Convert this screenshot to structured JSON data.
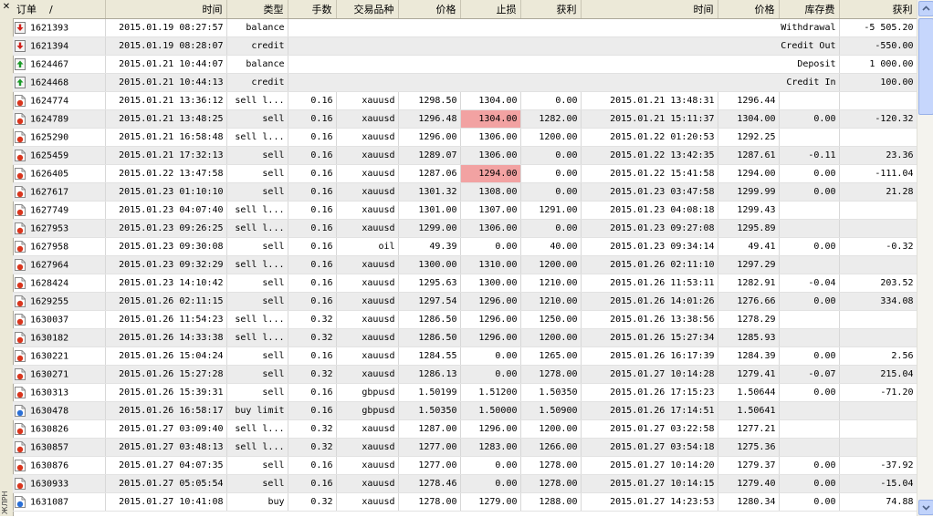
{
  "header": {
    "order": "订单",
    "sort_mark": "/",
    "open_time": "时间",
    "type": "类型",
    "lots": "手数",
    "symbol": "交易品种",
    "open_price": "价格",
    "stop_loss": "止损",
    "take_profit": "获利",
    "close_time": "时间",
    "close_price": "价格",
    "swap": "库存费",
    "profit": "获利"
  },
  "side_label": "ЖЛРН",
  "balance_rows": [
    {
      "icon": "withdraw-icon",
      "order": "1621393",
      "time": "2015.01.19 08:27:57",
      "type": "balance",
      "comment": "Withdrawal",
      "amount": "-5 505.20"
    },
    {
      "icon": "withdraw-icon",
      "order": "1621394",
      "time": "2015.01.19 08:28:07",
      "type": "credit",
      "comment": "Credit Out",
      "amount": "-550.00"
    },
    {
      "icon": "deposit-icon",
      "order": "1624467",
      "time": "2015.01.21 10:44:07",
      "type": "balance",
      "comment": "Deposit",
      "amount": "1 000.00"
    },
    {
      "icon": "deposit-icon",
      "order": "1624468",
      "time": "2015.01.21 10:44:13",
      "type": "credit",
      "comment": "Credit In",
      "amount": "100.00"
    }
  ],
  "trade_rows": [
    {
      "icon": "sell-order-icon",
      "order": "1624774",
      "open_time": "2015.01.21 13:36:12",
      "type": "sell l...",
      "lots": "0.16",
      "symbol": "xauusd",
      "open_price": "1298.50",
      "sl": "1304.00",
      "tp": "0.00",
      "close_time": "2015.01.21 13:48:31",
      "close_price": "1296.44",
      "swap": "",
      "profit": ""
    },
    {
      "icon": "sell-order-icon",
      "order": "1624789",
      "open_time": "2015.01.21 13:48:25",
      "type": "sell",
      "lots": "0.16",
      "symbol": "xauusd",
      "open_price": "1296.48",
      "sl": "1304.00",
      "tp": "1282.00",
      "close_time": "2015.01.21 15:11:37",
      "close_price": "1304.00",
      "swap": "0.00",
      "profit": "-120.32",
      "sl_hit": true
    },
    {
      "icon": "sell-order-icon",
      "order": "1625290",
      "open_time": "2015.01.21 16:58:48",
      "type": "sell l...",
      "lots": "0.16",
      "symbol": "xauusd",
      "open_price": "1296.00",
      "sl": "1306.00",
      "tp": "1200.00",
      "close_time": "2015.01.22 01:20:53",
      "close_price": "1292.25",
      "swap": "",
      "profit": ""
    },
    {
      "icon": "sell-order-icon",
      "order": "1625459",
      "open_time": "2015.01.21 17:32:13",
      "type": "sell",
      "lots": "0.16",
      "symbol": "xauusd",
      "open_price": "1289.07",
      "sl": "1306.00",
      "tp": "0.00",
      "close_time": "2015.01.22 13:42:35",
      "close_price": "1287.61",
      "swap": "-0.11",
      "profit": "23.36"
    },
    {
      "icon": "sell-order-icon",
      "order": "1626405",
      "open_time": "2015.01.22 13:47:58",
      "type": "sell",
      "lots": "0.16",
      "symbol": "xauusd",
      "open_price": "1287.06",
      "sl": "1294.00",
      "tp": "0.00",
      "close_time": "2015.01.22 15:41:58",
      "close_price": "1294.00",
      "swap": "0.00",
      "profit": "-111.04",
      "sl_hit": true
    },
    {
      "icon": "sell-order-icon",
      "order": "1627617",
      "open_time": "2015.01.23 01:10:10",
      "type": "sell",
      "lots": "0.16",
      "symbol": "xauusd",
      "open_price": "1301.32",
      "sl": "1308.00",
      "tp": "0.00",
      "close_time": "2015.01.23 03:47:58",
      "close_price": "1299.99",
      "swap": "0.00",
      "profit": "21.28"
    },
    {
      "icon": "sell-order-icon",
      "order": "1627749",
      "open_time": "2015.01.23 04:07:40",
      "type": "sell l...",
      "lots": "0.16",
      "symbol": "xauusd",
      "open_price": "1301.00",
      "sl": "1307.00",
      "tp": "1291.00",
      "close_time": "2015.01.23 04:08:18",
      "close_price": "1299.43",
      "swap": "",
      "profit": ""
    },
    {
      "icon": "sell-order-icon",
      "order": "1627953",
      "open_time": "2015.01.23 09:26:25",
      "type": "sell l...",
      "lots": "0.16",
      "symbol": "xauusd",
      "open_price": "1299.00",
      "sl": "1306.00",
      "tp": "0.00",
      "close_time": "2015.01.23 09:27:08",
      "close_price": "1295.89",
      "swap": "",
      "profit": ""
    },
    {
      "icon": "sell-order-icon",
      "order": "1627958",
      "open_time": "2015.01.23 09:30:08",
      "type": "sell",
      "lots": "0.16",
      "symbol": "oil",
      "open_price": "49.39",
      "sl": "0.00",
      "tp": "40.00",
      "close_time": "2015.01.23 09:34:14",
      "close_price": "49.41",
      "swap": "0.00",
      "profit": "-0.32"
    },
    {
      "icon": "sell-order-icon",
      "order": "1627964",
      "open_time": "2015.01.23 09:32:29",
      "type": "sell l...",
      "lots": "0.16",
      "symbol": "xauusd",
      "open_price": "1300.00",
      "sl": "1310.00",
      "tp": "1200.00",
      "close_time": "2015.01.26 02:11:10",
      "close_price": "1297.29",
      "swap": "",
      "profit": ""
    },
    {
      "icon": "sell-order-icon",
      "order": "1628424",
      "open_time": "2015.01.23 14:10:42",
      "type": "sell",
      "lots": "0.16",
      "symbol": "xauusd",
      "open_price": "1295.63",
      "sl": "1300.00",
      "tp": "1210.00",
      "close_time": "2015.01.26 11:53:11",
      "close_price": "1282.91",
      "swap": "-0.04",
      "profit": "203.52"
    },
    {
      "icon": "sell-order-icon",
      "order": "1629255",
      "open_time": "2015.01.26 02:11:15",
      "type": "sell",
      "lots": "0.16",
      "symbol": "xauusd",
      "open_price": "1297.54",
      "sl": "1296.00",
      "tp": "1210.00",
      "close_time": "2015.01.26 14:01:26",
      "close_price": "1276.66",
      "swap": "0.00",
      "profit": "334.08"
    },
    {
      "icon": "sell-order-icon",
      "order": "1630037",
      "open_time": "2015.01.26 11:54:23",
      "type": "sell l...",
      "lots": "0.32",
      "symbol": "xauusd",
      "open_price": "1286.50",
      "sl": "1296.00",
      "tp": "1250.00",
      "close_time": "2015.01.26 13:38:56",
      "close_price": "1278.29",
      "swap": "",
      "profit": ""
    },
    {
      "icon": "sell-order-icon",
      "order": "1630182",
      "open_time": "2015.01.26 14:33:38",
      "type": "sell l...",
      "lots": "0.32",
      "symbol": "xauusd",
      "open_price": "1286.50",
      "sl": "1296.00",
      "tp": "1200.00",
      "close_time": "2015.01.26 15:27:34",
      "close_price": "1285.93",
      "swap": "",
      "profit": ""
    },
    {
      "icon": "sell-order-icon",
      "order": "1630221",
      "open_time": "2015.01.26 15:04:24",
      "type": "sell",
      "lots": "0.16",
      "symbol": "xauusd",
      "open_price": "1284.55",
      "sl": "0.00",
      "tp": "1265.00",
      "close_time": "2015.01.26 16:17:39",
      "close_price": "1284.39",
      "swap": "0.00",
      "profit": "2.56"
    },
    {
      "icon": "sell-order-icon",
      "order": "1630271",
      "open_time": "2015.01.26 15:27:28",
      "type": "sell",
      "lots": "0.32",
      "symbol": "xauusd",
      "open_price": "1286.13",
      "sl": "0.00",
      "tp": "1278.00",
      "close_time": "2015.01.27 10:14:28",
      "close_price": "1279.41",
      "swap": "-0.07",
      "profit": "215.04"
    },
    {
      "icon": "sell-order-icon",
      "order": "1630313",
      "open_time": "2015.01.26 15:39:31",
      "type": "sell",
      "lots": "0.16",
      "symbol": "gbpusd",
      "open_price": "1.50199",
      "sl": "1.51200",
      "tp": "1.50350",
      "close_time": "2015.01.26 17:15:23",
      "close_price": "1.50644",
      "swap": "0.00",
      "profit": "-71.20"
    },
    {
      "icon": "buy-order-icon",
      "order": "1630478",
      "open_time": "2015.01.26 16:58:17",
      "type": "buy limit",
      "lots": "0.16",
      "symbol": "gbpusd",
      "open_price": "1.50350",
      "sl": "1.50000",
      "tp": "1.50900",
      "close_time": "2015.01.26 17:14:51",
      "close_price": "1.50641",
      "swap": "",
      "profit": ""
    },
    {
      "icon": "sell-order-icon",
      "order": "1630826",
      "open_time": "2015.01.27 03:09:40",
      "type": "sell l...",
      "lots": "0.32",
      "symbol": "xauusd",
      "open_price": "1287.00",
      "sl": "1296.00",
      "tp": "1200.00",
      "close_time": "2015.01.27 03:22:58",
      "close_price": "1277.21",
      "swap": "",
      "profit": ""
    },
    {
      "icon": "sell-order-icon",
      "order": "1630857",
      "open_time": "2015.01.27 03:48:13",
      "type": "sell l...",
      "lots": "0.32",
      "symbol": "xauusd",
      "open_price": "1277.00",
      "sl": "1283.00",
      "tp": "1266.00",
      "close_time": "2015.01.27 03:54:18",
      "close_price": "1275.36",
      "swap": "",
      "profit": ""
    },
    {
      "icon": "sell-order-icon",
      "order": "1630876",
      "open_time": "2015.01.27 04:07:35",
      "type": "sell",
      "lots": "0.16",
      "symbol": "xauusd",
      "open_price": "1277.00",
      "sl": "0.00",
      "tp": "1278.00",
      "close_time": "2015.01.27 10:14:20",
      "close_price": "1279.37",
      "swap": "0.00",
      "profit": "-37.92"
    },
    {
      "icon": "sell-order-icon",
      "order": "1630933",
      "open_time": "2015.01.27 05:05:54",
      "type": "sell",
      "lots": "0.16",
      "symbol": "xauusd",
      "open_price": "1278.46",
      "sl": "0.00",
      "tp": "1278.00",
      "close_time": "2015.01.27 10:14:15",
      "close_price": "1279.40",
      "swap": "0.00",
      "profit": "-15.04"
    },
    {
      "icon": "buy-order-icon",
      "order": "1631087",
      "open_time": "2015.01.27 10:41:08",
      "type": "buy",
      "lots": "0.32",
      "symbol": "xauusd",
      "open_price": "1278.00",
      "sl": "1279.00",
      "tp": "1288.00",
      "close_time": "2015.01.27 14:23:53",
      "close_price": "1280.34",
      "swap": "0.00",
      "profit": "74.88"
    }
  ],
  "colors": {
    "header_bg": "#ece9d8",
    "alt_row_bg": "#ececec",
    "sl_hit_bg": "#f2a2a2",
    "withdraw_arrow": "#d0201a",
    "deposit_arrow": "#1a9a28",
    "sell_marker": "#d9361e",
    "buy_marker": "#2a6fd6"
  }
}
